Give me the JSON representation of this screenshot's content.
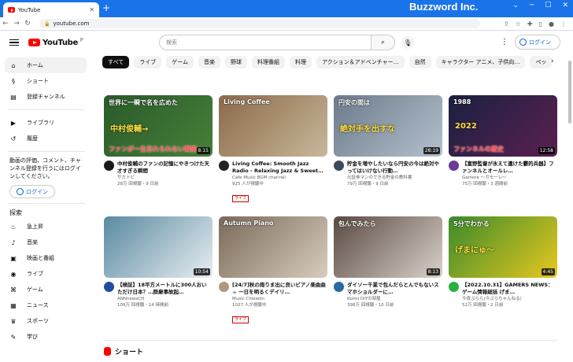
{
  "browser": {
    "tab_title": "YouTube",
    "url": "youtube.com",
    "brand": "Buzzword Inc."
  },
  "header": {
    "logo": "YouTube",
    "logo_sup": "JP",
    "search_placeholder": "検索",
    "login": "ログイン"
  },
  "sidebar": {
    "items": [
      {
        "label": "ホーム",
        "icon": "home-icon"
      },
      {
        "label": "ショート",
        "icon": "shorts-icon"
      },
      {
        "label": "登録チャンネル",
        "icon": "subscriptions-icon"
      }
    ],
    "items2": [
      {
        "label": "ライブラリ",
        "icon": "library-icon"
      },
      {
        "label": "履歴",
        "icon": "history-icon"
      }
    ],
    "promo": "動画の評価、コメント、チャンネル登録を行うにはログインしてください。",
    "login": "ログイン",
    "explore_head": "探索",
    "explore": [
      {
        "label": "急上昇",
        "icon": "trending-icon"
      },
      {
        "label": "音楽",
        "icon": "music-icon"
      },
      {
        "label": "映画と番組",
        "icon": "movies-icon"
      },
      {
        "label": "ライブ",
        "icon": "live-icon"
      },
      {
        "label": "ゲーム",
        "icon": "gaming-icon"
      },
      {
        "label": "ニュース",
        "icon": "news-icon"
      },
      {
        "label": "スポーツ",
        "icon": "sports-icon"
      },
      {
        "label": "学び",
        "icon": "learning-icon"
      }
    ]
  },
  "chips": [
    "すべて",
    "ライブ",
    "ゲーム",
    "音楽",
    "野球",
    "料理番組",
    "料理",
    "アクション＆アドベンチャー…",
    "自然",
    "キャラクター アニメ、子供向…",
    "ペッ"
  ],
  "videos": [
    {
      "title": "中村俊輔のファンの記憶にやきつけた天才すぎる瞬間",
      "channel": "サカトピ",
      "stats": "28万 回視聴・9 日前",
      "duration": "8:15",
      "thumb_text": "世界に一瞬で名を広めた",
      "thumb_text2": "中村俊輔→",
      "thumb_text3": "ファンが一生忘れられない瞬間",
      "colors": [
        "#2a5a2a",
        "#47803a"
      ],
      "avatar": "#1a1a1a",
      "live": ""
    },
    {
      "title": "Living Coffee: Smooth Jazz Radio - Relaxing Jazz & Sweet…",
      "channel": "Cafe Music BGM channel",
      "stats": "925 人が視聴中",
      "duration": "",
      "thumb_text": "Living Coffee",
      "thumb_text2": "",
      "thumb_text3": "",
      "colors": [
        "#8b6a4a",
        "#c8b79a"
      ],
      "avatar": "#222222",
      "live": "ライブ"
    },
    {
      "title": "貯金を増やしたいなら円安の今は絶対やってはいけない行動…",
      "channel": "元証券マンのできる貯金の教科書",
      "stats": "79万 回視聴・9 日前",
      "duration": "28:19",
      "thumb_text": "円安の間は",
      "thumb_text2": "絶対手を出すな",
      "thumb_text3": "",
      "colors": [
        "#6b7b8b",
        "#b5c0cc"
      ],
      "avatar": "#3b4a5a",
      "live": ""
    },
    {
      "title": "【富野監督が氷えて遺けた鬱的兵器】ファンネルとオールレ…",
      "channel": "Gamore ～ガモーレ～",
      "stats": "75万 回視聴・3 週間前",
      "duration": "12:58",
      "thumb_text": "1988",
      "thumb_text2": "2022",
      "thumb_text3": "ファンネルの歴史",
      "colors": [
        "#1a2040",
        "#5a2050"
      ],
      "avatar": "#6a3a9a",
      "live": ""
    },
    {
      "title": "【検証】18平方メートルに300人おいただけ日本？…群衆事故起…",
      "channel": "ANNnewsCH",
      "stats": "109万 回視聴・14 時間前",
      "duration": "10:54",
      "thumb_text": "",
      "thumb_text2": "",
      "thumb_text3": "",
      "colors": [
        "#5a8aa0",
        "#e8eef2"
      ],
      "avatar": "#1e4ea0",
      "live": ""
    },
    {
      "title": "[24/7]秋の雨りま出に良いビアノ楽曲曲☕ 一日を明るくデイリ…",
      "channel": "Music Chiewdn",
      "stats": "1027 人が視聴中",
      "duration": "",
      "thumb_text": "Autumn Piano",
      "thumb_text2": "",
      "thumb_text3": "",
      "colors": [
        "#7a6a5a",
        "#d8cdbd"
      ],
      "avatar": "#b0987a",
      "live": "ライブ"
    },
    {
      "title": "ダイソー千業で包んだらとんでもないスマホショルダーに…",
      "channel": "Koimi DIYの部屋",
      "stats": "398万 回視聴・10 日前",
      "duration": "8:13",
      "thumb_text": "包んでみたら",
      "thumb_text2": "",
      "thumb_text3": "",
      "colors": [
        "#5a4a42",
        "#d9d2ca"
      ],
      "avatar": "#2a6aa0",
      "live": ""
    },
    {
      "title": "【2022.10.31】GAMERS NEWS：ゲーム情報総括 げま…",
      "channel": "今夜ぷらら(今ぷらちゃんねる)",
      "stats": "52万 回視聴・2 日前",
      "duration": "4:45",
      "thumb_text": "5分でわかる",
      "thumb_text2": "げまにゅ～",
      "thumb_text3": "",
      "colors": [
        "#3a8a2a",
        "#e8c820"
      ],
      "avatar": "#2ab040",
      "live": ""
    }
  ],
  "shorts_label": "ショート"
}
